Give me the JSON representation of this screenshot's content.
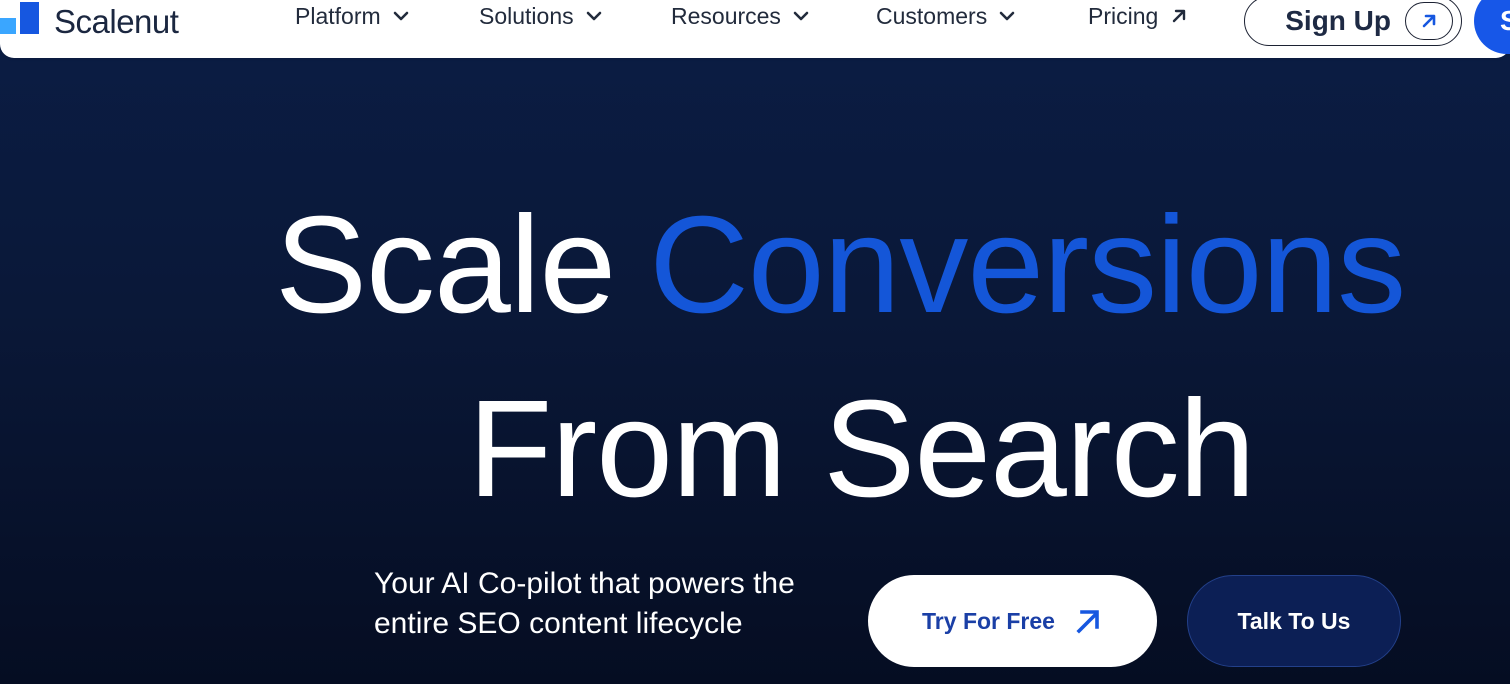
{
  "brand": {
    "name": "Scalenut"
  },
  "nav": {
    "items": [
      {
        "label": "Platform",
        "icon": "chevron-down-icon"
      },
      {
        "label": "Solutions",
        "icon": "chevron-down-icon"
      },
      {
        "label": "Resources",
        "icon": "chevron-down-icon"
      },
      {
        "label": "Customers",
        "icon": "chevron-down-icon"
      },
      {
        "label": "Pricing",
        "icon": "arrow-up-right-icon"
      }
    ],
    "signup_label": "Sign Up",
    "login_label": "S"
  },
  "hero": {
    "headline_word1": "Scale",
    "headline_word2": "Conversions",
    "headline_line2": "From Search",
    "subtext": "Your AI Co-pilot that powers the entire SEO content lifecycle",
    "try_label": "Try For Free",
    "talk_label": "Talk To Us"
  },
  "colors": {
    "accent": "#1456d8",
    "background": "#0a1a3c",
    "button_text": "#1a3fa6"
  }
}
